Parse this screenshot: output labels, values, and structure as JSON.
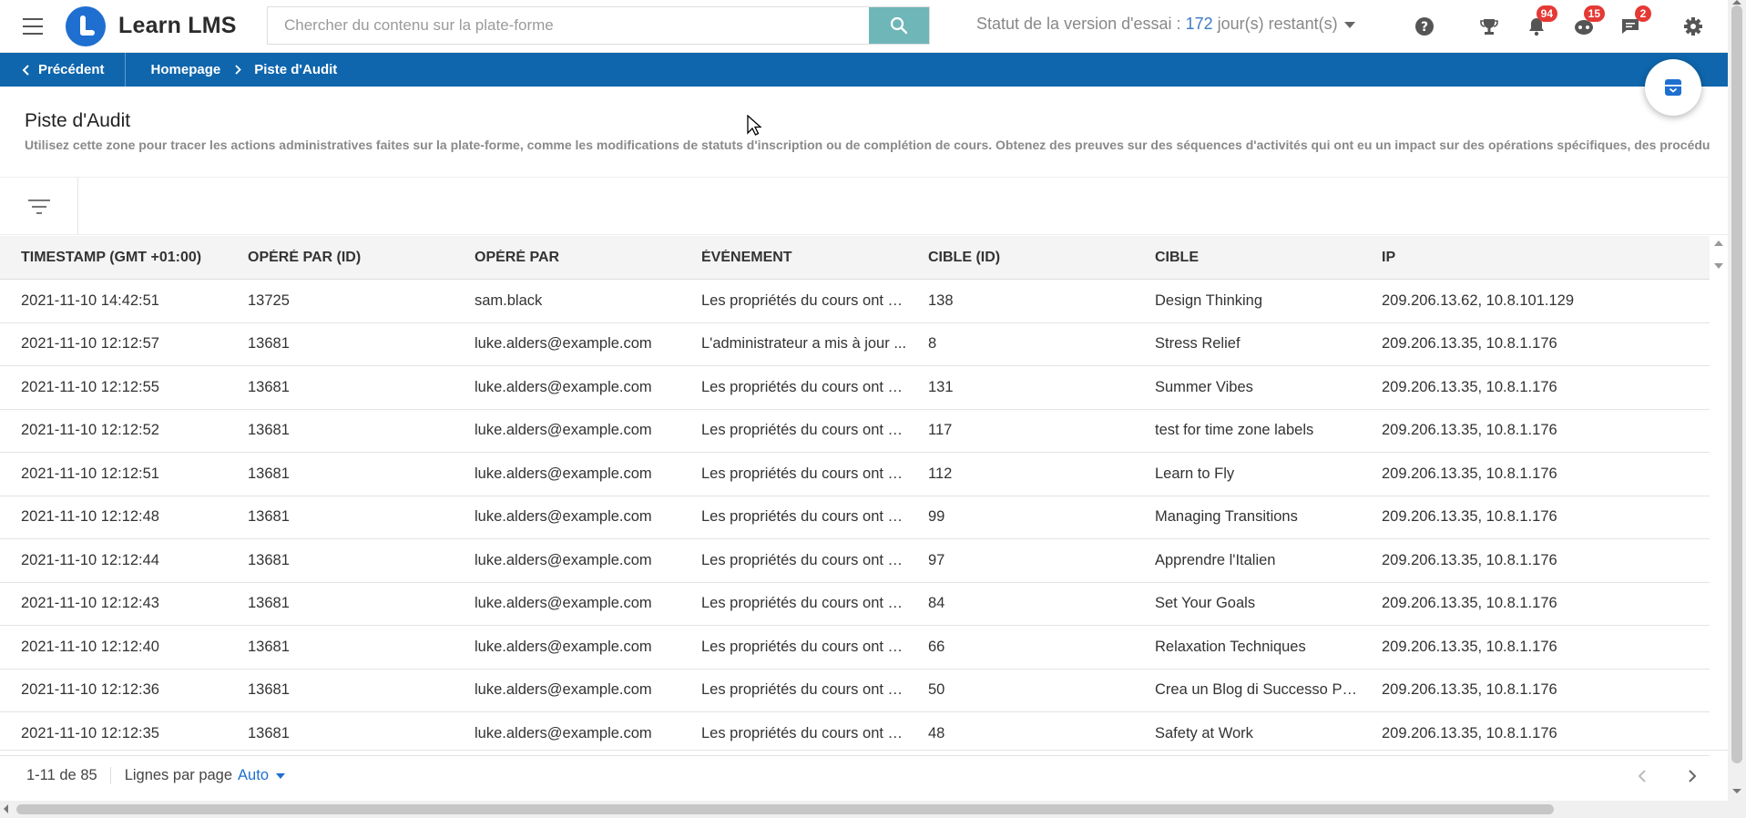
{
  "app": {
    "logo_text": "Learn LMS",
    "accent": "#0f66ad",
    "search_button_color": "#6fb6b9"
  },
  "search": {
    "placeholder": "Chercher du contenu sur la plate-forme"
  },
  "trial": {
    "prefix": "Statut de la version d'essai : ",
    "days": "172",
    "suffix": " jour(s) restant(s)"
  },
  "header_icons": [
    {
      "icon": "help-icon"
    },
    {
      "icon": "trophy-icon"
    },
    {
      "icon": "bell-icon",
      "badge": "94"
    },
    {
      "icon": "robot-icon",
      "badge": "15"
    },
    {
      "icon": "chat-icon",
      "badge": "2"
    },
    {
      "icon": "gear-icon"
    }
  ],
  "breadcrumb": {
    "back_label": "Précédent",
    "home_label": "Homepage",
    "current_label": "Piste d'Audit"
  },
  "page": {
    "title": "Piste d'Audit",
    "description": "Utilisez cette zone pour tracer les actions administratives faites sur la plate-forme, comme les modifications de statuts d'inscription ou de complétion de cours. Obtenez des preuves sur des séquences d'activités qui ont eu un impact sur des opérations spécifiques, des procédu"
  },
  "table": {
    "columns": [
      "TIMESTAMP (GMT +01:00)",
      "OPÉRÉ PAR (ID)",
      "OPÉRÉ PAR",
      "ÉVÉNEMENT",
      "CIBLE (ID)",
      "CIBLE",
      "IP"
    ],
    "rows": [
      [
        "2021-11-10 14:42:51",
        "13725",
        "sam.black",
        "Les propriétés du cours ont c...",
        "138",
        "Design Thinking",
        "209.206.13.62, 10.8.101.129"
      ],
      [
        "2021-11-10 12:12:57",
        "13681",
        "luke.alders@example.com",
        "L'administrateur a mis à jour ...",
        "8",
        "Stress Relief",
        "209.206.13.35, 10.8.1.176"
      ],
      [
        "2021-11-10 12:12:55",
        "13681",
        "luke.alders@example.com",
        "Les propriétés du cours ont c...",
        "131",
        "Summer Vibes",
        "209.206.13.35, 10.8.1.176"
      ],
      [
        "2021-11-10 12:12:52",
        "13681",
        "luke.alders@example.com",
        "Les propriétés du cours ont c...",
        "117",
        "test for time zone labels",
        "209.206.13.35, 10.8.1.176"
      ],
      [
        "2021-11-10 12:12:51",
        "13681",
        "luke.alders@example.com",
        "Les propriétés du cours ont c...",
        "112",
        "Learn to Fly",
        "209.206.13.35, 10.8.1.176"
      ],
      [
        "2021-11-10 12:12:48",
        "13681",
        "luke.alders@example.com",
        "Les propriétés du cours ont c...",
        "99",
        "Managing Transitions",
        "209.206.13.35, 10.8.1.176"
      ],
      [
        "2021-11-10 12:12:44",
        "13681",
        "luke.alders@example.com",
        "Les propriétés du cours ont c...",
        "97",
        "Apprendre l'Italien",
        "209.206.13.35, 10.8.1.176"
      ],
      [
        "2021-11-10 12:12:43",
        "13681",
        "luke.alders@example.com",
        "Les propriétés du cours ont c...",
        "84",
        "Set Your Goals",
        "209.206.13.35, 10.8.1.176"
      ],
      [
        "2021-11-10 12:12:40",
        "13681",
        "luke.alders@example.com",
        "Les propriétés du cours ont c...",
        "66",
        "Relaxation Techniques",
        "209.206.13.35, 10.8.1.176"
      ],
      [
        "2021-11-10 12:12:36",
        "13681",
        "luke.alders@example.com",
        "Les propriétés du cours ont c...",
        "50",
        "Crea un Blog di Successo Par...",
        "209.206.13.35, 10.8.1.176"
      ],
      [
        "2021-11-10 12:12:35",
        "13681",
        "luke.alders@example.com",
        "Les propriétés du cours ont c...",
        "48",
        "Safety at Work",
        "209.206.13.35, 10.8.1.176"
      ]
    ]
  },
  "pager": {
    "range": "1-11 de 85",
    "rows_per_page_label": "Lignes par page",
    "rows_per_page_value": "Auto"
  }
}
